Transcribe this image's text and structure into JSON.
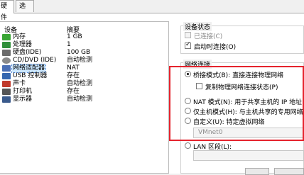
{
  "tabs": [
    {
      "label": "硬件",
      "active": true
    },
    {
      "label": "选项",
      "active": false
    }
  ],
  "device_list": {
    "headers": {
      "device": "设备",
      "summary": "摘要"
    },
    "rows": [
      {
        "name": "内存",
        "summary": "1 GB",
        "icon": "memory-icon",
        "color": "#3aa635",
        "selected": false
      },
      {
        "name": "处理器",
        "summary": "1",
        "icon": "processor-icon",
        "color": "#2f8f3a",
        "selected": false
      },
      {
        "name": "硬盘(IDE)",
        "summary": "100 GB",
        "icon": "harddisk-icon",
        "color": "#6b6b6b",
        "selected": false
      },
      {
        "name": "CD/DVD (IDE)",
        "summary": "自动检测",
        "icon": "cd-dvd-icon",
        "color": "#8a8a8a",
        "selected": false
      },
      {
        "name": "网络适配器",
        "summary": "NAT",
        "icon": "network-adapter-icon",
        "color": "#4a6fb5",
        "selected": true
      },
      {
        "name": "USB 控制器",
        "summary": "存在",
        "icon": "usb-icon",
        "color": "#3466b0",
        "selected": false
      },
      {
        "name": "声卡",
        "summary": "自动检测",
        "icon": "sound-card-icon",
        "color": "#c0392b",
        "selected": false
      },
      {
        "name": "打印机",
        "summary": "存在",
        "icon": "printer-icon",
        "color": "#555555",
        "selected": false
      },
      {
        "name": "显示器",
        "summary": "自动检测",
        "icon": "monitor-icon",
        "color": "#3a5a8c",
        "selected": false
      }
    ]
  },
  "device_status": {
    "title": "设备状态",
    "connected": {
      "label": "已连接(C)",
      "checked": false,
      "enabled": false
    },
    "connect_at_power_on": {
      "label": "启动时连接(O)",
      "checked": true,
      "enabled": true
    }
  },
  "network_connection": {
    "title": "网络连接",
    "bridged": {
      "label": "桥接模式(B): 直接连接物理网络",
      "selected": true
    },
    "replicate": {
      "label": "复制物理网络连接状态(P)",
      "checked": false
    },
    "nat": {
      "label": "NAT 模式(N): 用于共享主机的 IP 地址",
      "selected": false
    },
    "host_only": {
      "label": "仅主机模式(H): 与主机共享的专用网络",
      "selected": false
    },
    "custom": {
      "label": "自定义(U): 特定虚拟网络",
      "selected": false
    },
    "custom_value": "VMnet0",
    "lan_segment": {
      "label": "LAN 区段(L):",
      "selected": false
    }
  },
  "highlight_color": "#e5232d"
}
